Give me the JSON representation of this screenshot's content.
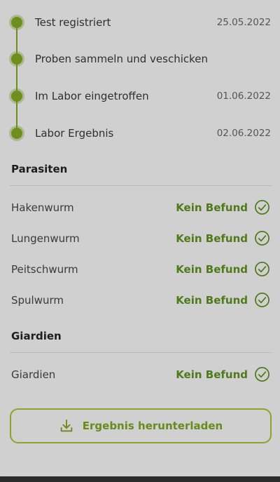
{
  "timeline": {
    "steps": [
      {
        "label": "Test registriert",
        "date": "25.05.2022"
      },
      {
        "label": "Proben sammeln und veschicken",
        "date": ""
      },
      {
        "label": "Im Labor eingetroffen",
        "date": "01.06.2022"
      },
      {
        "label": "Labor Ergebnis",
        "date": "02.06.2022"
      }
    ]
  },
  "parasiten": {
    "title": "Parasiten",
    "rows": [
      {
        "name": "Hakenwurm",
        "status": "Kein Befund"
      },
      {
        "name": "Lungenwurm",
        "status": "Kein Befund"
      },
      {
        "name": "Peitschwurm",
        "status": "Kein Befund"
      },
      {
        "name": "Spulwurm",
        "status": "Kein Befund"
      }
    ]
  },
  "giardien": {
    "title": "Giardien",
    "rows": [
      {
        "name": "Giardien",
        "status": "Kein Befund"
      }
    ]
  },
  "download": {
    "label": "Ergebnis herunterladen",
    "icon": "download-icon"
  },
  "colors": {
    "accent": "#6e8e1e",
    "status_text": "#4f7a1a",
    "background": "#d0d0d0"
  }
}
